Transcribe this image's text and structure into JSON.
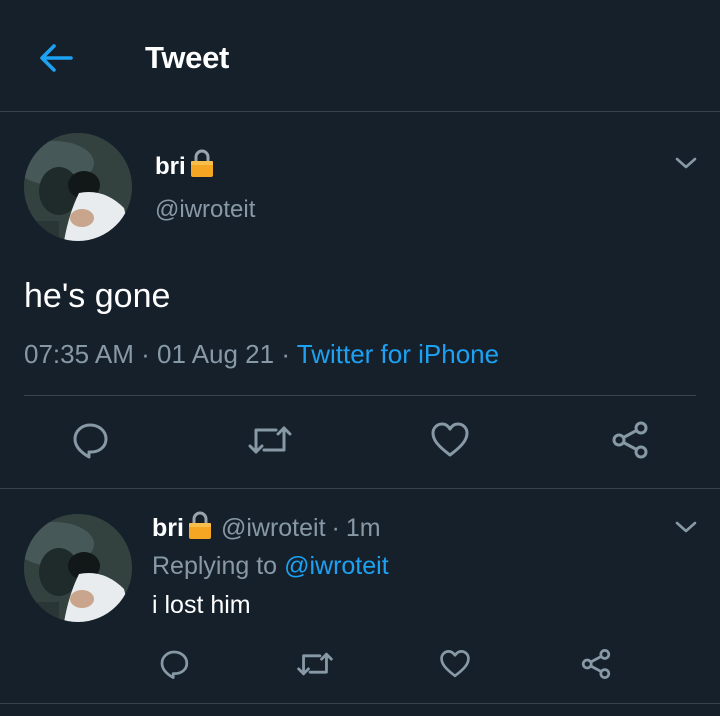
{
  "header": {
    "title": "Tweet",
    "back_icon": "arrow-left-icon",
    "accent": "#1da1f2"
  },
  "tweet": {
    "display_name": "bri",
    "lock_icon": "lock-icon",
    "handle": "@iwroteit",
    "text": "he's gone",
    "time": "07:35 AM",
    "separator": "·",
    "date": "01 Aug 21",
    "source": "Twitter for iPhone",
    "actions": [
      "reply-icon",
      "retweet-icon",
      "like-icon",
      "share-icon"
    ]
  },
  "reply": {
    "display_name": "bri",
    "lock_icon": "lock-icon",
    "handle": "@iwroteit",
    "separator": "·",
    "time": "1m",
    "replying_label": "Replying to",
    "replying_to": "@iwroteit",
    "text": "i lost him",
    "actions": [
      "reply-icon",
      "retweet-icon",
      "like-icon",
      "share-icon"
    ]
  },
  "colors": {
    "background": "#15202b",
    "border": "#38444d",
    "secondary_text": "#8899a6",
    "primary_text": "#ffffff",
    "link": "#1da1f2",
    "lock": "#f5a623"
  }
}
